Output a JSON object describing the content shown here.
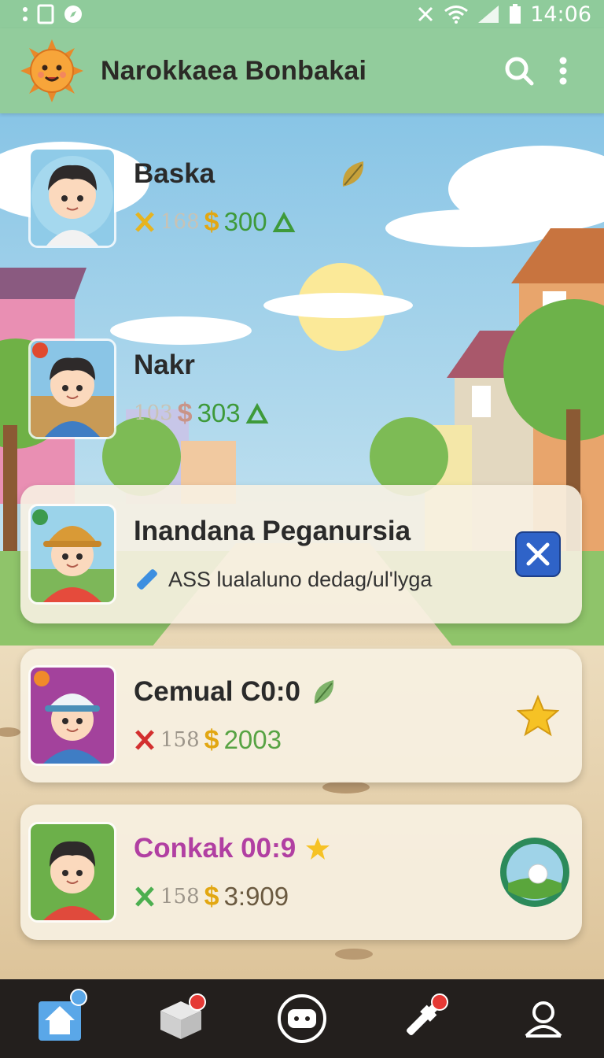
{
  "status_bar": {
    "time": "14:06"
  },
  "app_bar": {
    "title": "Narokkaea Bonbakai"
  },
  "cards": [
    {
      "name": "Baska",
      "stat_count": "168",
      "money": "300",
      "money_color": "#3e9a3a"
    },
    {
      "name": "Nakr",
      "stat_count": "103",
      "money": "303",
      "money_color": "#3e9a3a"
    },
    {
      "name": "Inandana Peganursia",
      "description": "ASS lualaluno dedag/ul'lyga"
    },
    {
      "name": "Cemual C0:0",
      "stat_count": "158",
      "money": "2003",
      "money_color": "#57a343"
    },
    {
      "name": "Conkak 00:9",
      "name_color": "#b13fa2",
      "stat_count": "158",
      "money": "3:909",
      "money_color": "#6b5a40"
    }
  ],
  "bottom_nav": {
    "items": [
      {
        "icon": "home-icon",
        "badge": false
      },
      {
        "icon": "box-icon",
        "badge": true
      },
      {
        "icon": "game-controller-icon",
        "badge": false
      },
      {
        "icon": "tools-icon",
        "badge": true
      },
      {
        "icon": "profile-icon",
        "badge": false
      }
    ]
  },
  "colors": {
    "app_bar": "#92cc9c",
    "nav_bg": "#231f1d",
    "accent_gold": "#e2a712",
    "accent_green": "#3e9a3a"
  }
}
